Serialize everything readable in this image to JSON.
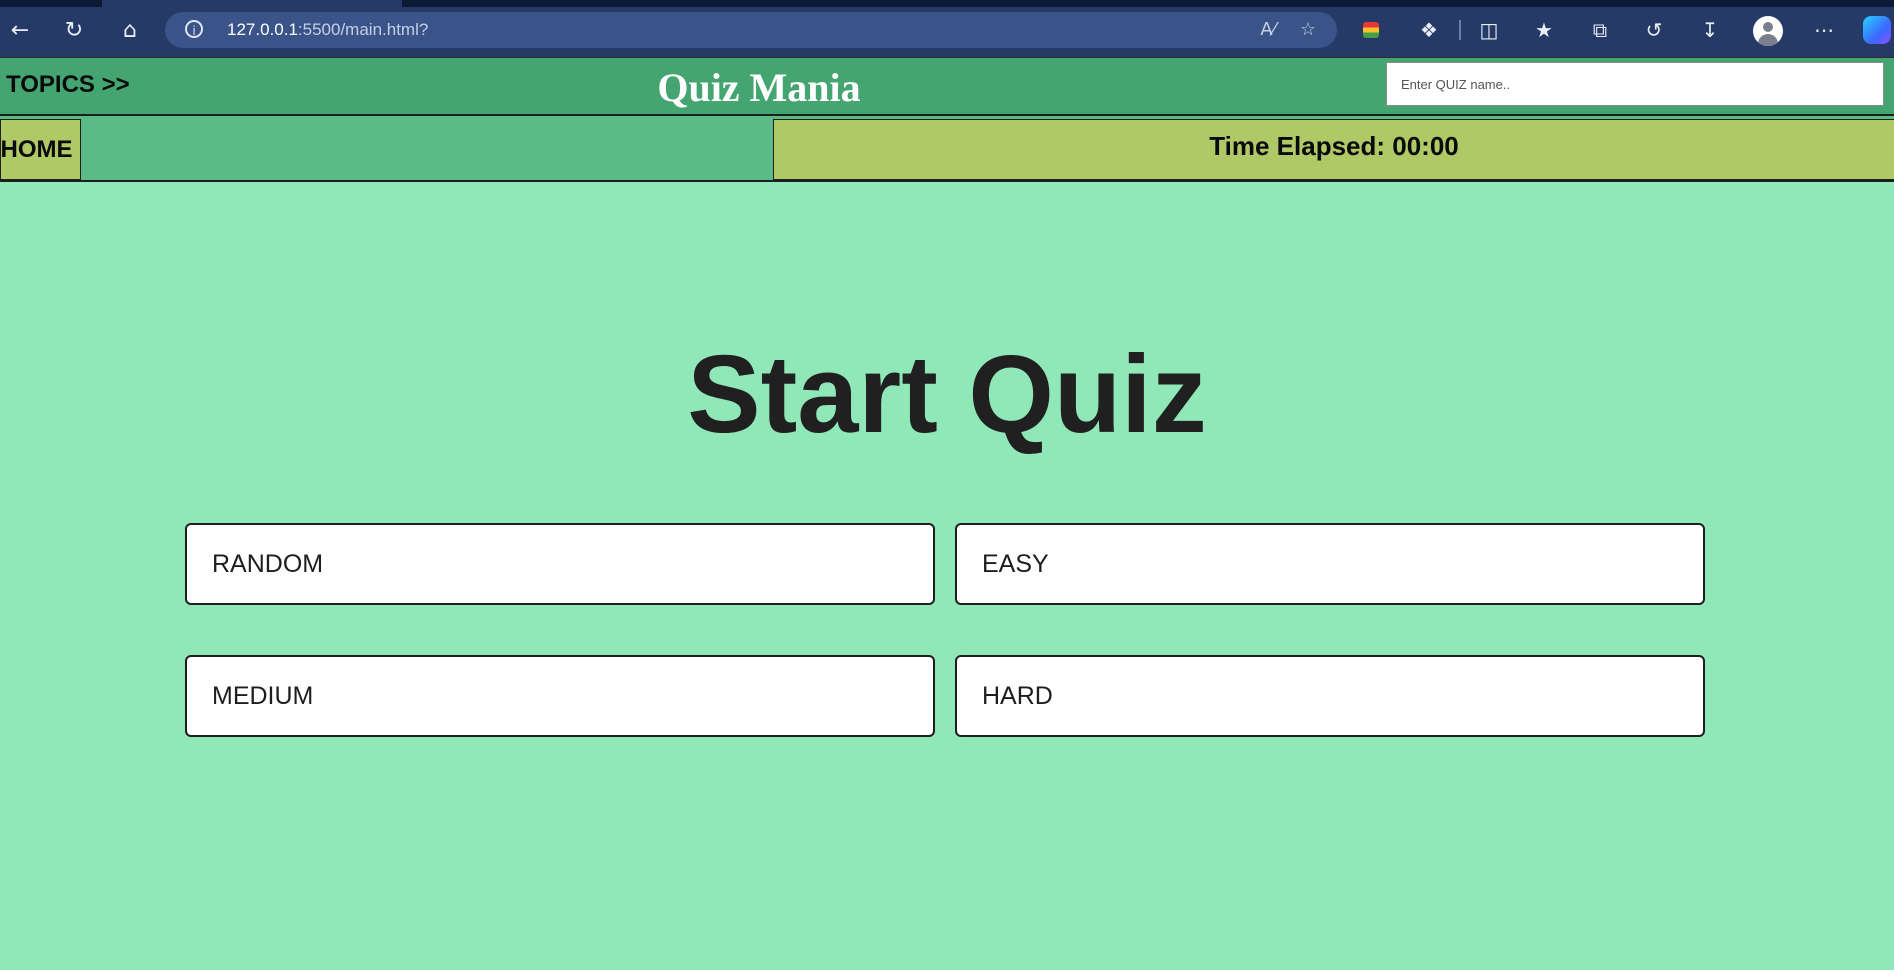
{
  "browser": {
    "url_host": "127.0.0.1",
    "url_path": ":5500/main.html?",
    "icons": {
      "back": "back-arrow-icon",
      "reload": "reload-icon",
      "home": "home-icon",
      "info": "info-icon",
      "read_aloud": "read-aloud-icon",
      "favorite": "star-icon",
      "extension": "extension-puzzle-icon",
      "split_screen": "split-screen-icon",
      "favorites": "favorites-icon",
      "collections": "collections-icon",
      "history": "history-icon",
      "downloads": "downloads-icon",
      "profile": "profile-icon",
      "more": "more-icon",
      "copilot": "copilot-icon"
    }
  },
  "header": {
    "topics_label": "TOPICS >>",
    "title": "Quiz Mania",
    "search_placeholder": "Enter QUIZ name.."
  },
  "subbar": {
    "home_label": "HOME",
    "timer_text": "Time Elapsed: 00:00"
  },
  "main": {
    "heading": "Start Quiz",
    "options": [
      "RANDOM",
      "EASY",
      "MEDIUM",
      "HARD"
    ]
  },
  "colors": {
    "page_bg": "#90e8b8",
    "header_bg": "#45a571",
    "subbar_bg": "#5cba87",
    "accent_yellow_green": "#afc966",
    "browser_bg": "#253a66"
  }
}
